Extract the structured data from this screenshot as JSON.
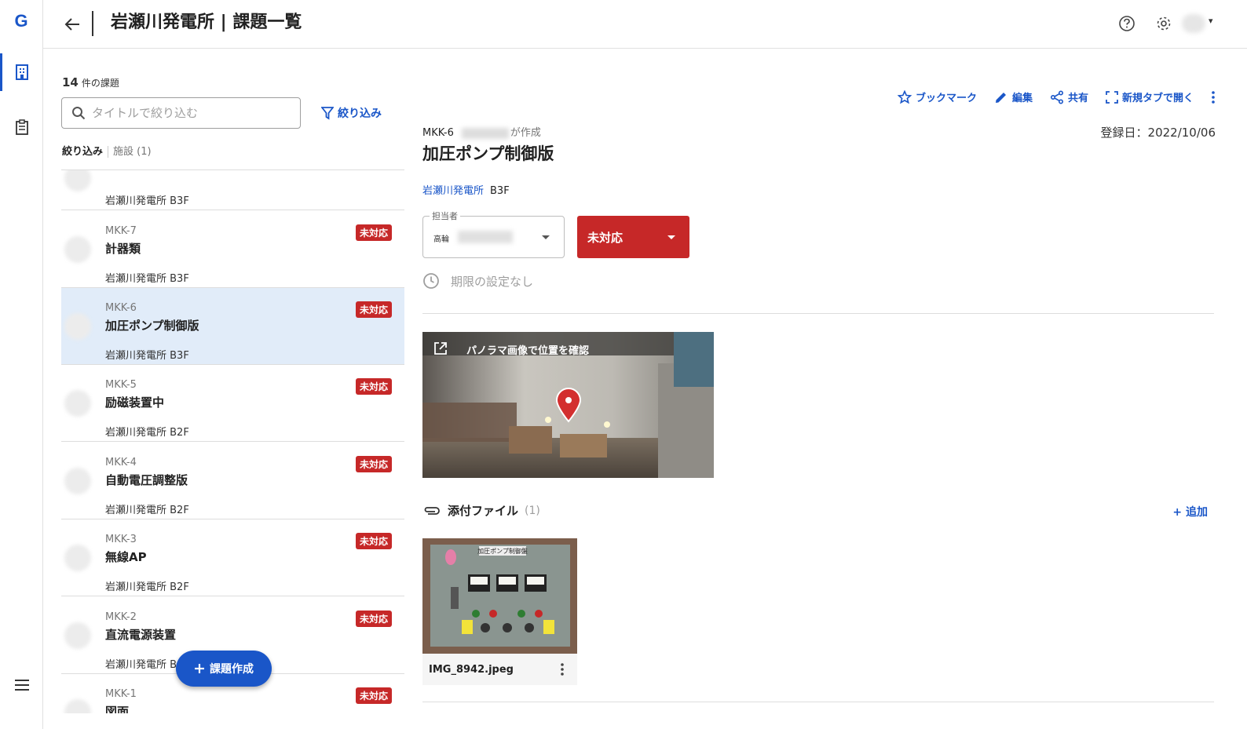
{
  "rail": {
    "logo": "G"
  },
  "header": {
    "title": "岩瀬川発電所 | 課題一覧"
  },
  "list_panel": {
    "count": "14",
    "count_suffix": "件の課題",
    "search_placeholder": "タイトルで絞り込む",
    "filter_button": "絞り込み",
    "filter_label": "絞り込み",
    "filter_chip": "施設 (1)",
    "partial_top_item": {
      "loc": "岩瀬川発電所 B3F"
    },
    "items": [
      {
        "code": "MKK-7",
        "name": "計器類",
        "loc": "岩瀬川発電所 B3F",
        "status": "未対応"
      },
      {
        "code": "MKK-6",
        "name": "加圧ポンプ制御版",
        "loc": "岩瀬川発電所 B3F",
        "status": "未対応"
      },
      {
        "code": "MKK-5",
        "name": "励磁装置中",
        "loc": "岩瀬川発電所 B2F",
        "status": "未対応"
      },
      {
        "code": "MKK-4",
        "name": "自動電圧調整版",
        "loc": "岩瀬川発電所 B2F",
        "status": "未対応"
      },
      {
        "code": "MKK-3",
        "name": "無線AP",
        "loc": "岩瀬川発電所 B2F",
        "status": "未対応"
      },
      {
        "code": "MKK-2",
        "name": "直流電源装置",
        "loc": "岩瀬川発電所 B",
        "status": "未対応"
      },
      {
        "code": "MKK-1",
        "name": "図面",
        "loc": "",
        "status": "未対応"
      }
    ],
    "fab_label": "課題作成"
  },
  "detail": {
    "actions": {
      "bookmark": "ブックマーク",
      "edit": "編集",
      "share": "共有",
      "open_new_tab": "新規タブで開く"
    },
    "code": "MKK-6",
    "created_by_suffix": "が作成",
    "registered": "登録日：2022/10/06",
    "title": "加圧ポンプ制御版",
    "location_link": "岩瀬川発電所",
    "floor": "B3F",
    "assignee_label": "担当者",
    "assignee_prefix": "高輪",
    "status": "未対応",
    "deadline": "期限の設定なし",
    "panorama_label": "パノラマ画像で位置を確認",
    "attachments_label": "添付ファイル",
    "attachments_count": "(1)",
    "add_label": "+ 追加",
    "file_name": "IMG_8942.jpeg",
    "thumb_caption": "加圧ポンプ制御盤"
  },
  "colors": {
    "accent": "#1a56c8",
    "status_red": "#c62828",
    "selected_bg": "#e1ecf9"
  }
}
